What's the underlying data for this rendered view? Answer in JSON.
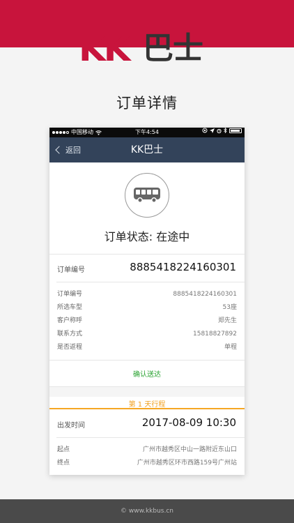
{
  "brand": {
    "logo_latin": "KK",
    "logo_cn": "巴士",
    "color_red": "#c8143c"
  },
  "caption": "订单详情",
  "statusbar": {
    "carrier": "中国移动",
    "time": "下午4:54"
  },
  "navbar": {
    "back_label": "返回",
    "title": "KK巴士",
    "bg": "#33435a"
  },
  "order": {
    "status_text": "订单状态: 在途中",
    "number_label": "订单编号",
    "number_value": "8885418224160301",
    "details": [
      {
        "label": "订单编号",
        "value": "8885418224160301"
      },
      {
        "label": "所选车型",
        "value": "53座"
      },
      {
        "label": "客户称呼",
        "value": "郑先生"
      },
      {
        "label": "联系方式",
        "value": "15818827892"
      },
      {
        "label": "是否返程",
        "value": "单程"
      }
    ],
    "confirm_label": "确认送达"
  },
  "itinerary": {
    "day_title": "第 1 天行程",
    "depart_label": "出发时间",
    "depart_value": "2017-08-09 10:30",
    "start_label": "起点",
    "start_value": "广州市越秀区中山一路附近东山口",
    "end_label": "终点",
    "end_value": "广州市越秀区环市西路159号广州站"
  },
  "footer": {
    "text": "© www.kkbus.cn"
  }
}
